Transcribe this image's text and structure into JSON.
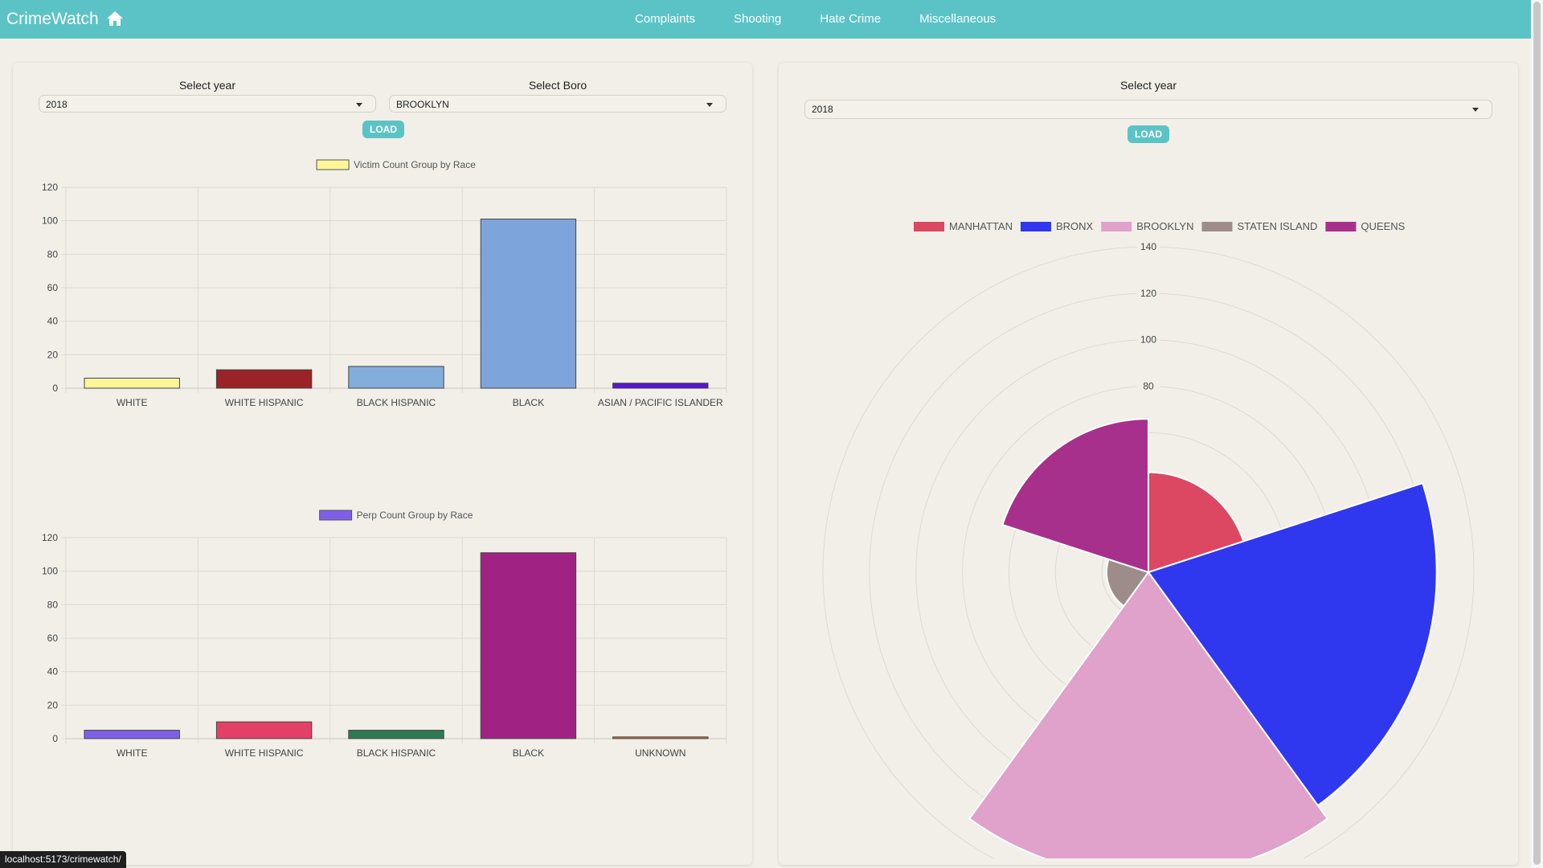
{
  "navbar": {
    "brand": "CrimeWatch",
    "links": [
      "Complaints",
      "Shooting",
      "Hate Crime",
      "Miscellaneous"
    ],
    "bg_color": "#5bc3c6"
  },
  "left_panel": {
    "year_label": "Select year",
    "year_value": "2018",
    "boro_label": "Select Boro",
    "boro_value": "BROOKLYN",
    "load_label": "LOAD"
  },
  "right_panel": {
    "year_label": "Select year",
    "year_value": "2018",
    "load_label": "LOAD"
  },
  "status_url": "localhost:5173/crimewatch/",
  "chart_data": [
    {
      "type": "bar",
      "legend": "Victim Count Group by Race",
      "legend_color": "#fdf59a",
      "categories": [
        "WHITE",
        "WHITE HISPANIC",
        "BLACK HISPANIC",
        "BLACK",
        "ASIAN / PACIFIC ISLANDER"
      ],
      "values": [
        6,
        11,
        13,
        101,
        3
      ],
      "colors": [
        "#fdf59a",
        "#9b2226",
        "#83aedc",
        "#7ea4dc",
        "#5a14d4"
      ],
      "yticks": [
        "0",
        "20",
        "40",
        "60",
        "80",
        "100",
        "120"
      ],
      "ylim": [
        0,
        120
      ]
    },
    {
      "type": "bar",
      "legend": "Perp Count Group by Race",
      "legend_color": "#7f5fe8",
      "categories": [
        "WHITE",
        "WHITE HISPANIC",
        "BLACK HISPANIC",
        "BLACK",
        "UNKNOWN"
      ],
      "values": [
        5,
        10,
        5,
        111,
        1
      ],
      "colors": [
        "#7f5fe8",
        "#e34067",
        "#2d7a55",
        "#a02384",
        "#d4703a"
      ],
      "yticks": [
        "0",
        "20",
        "40",
        "60",
        "80",
        "100",
        "120"
      ],
      "ylim": [
        0,
        120
      ]
    },
    {
      "type": "polar-area",
      "series": [
        {
          "name": "MANHATTAN",
          "value": 43,
          "color": "#dc4762"
        },
        {
          "name": "BRONX",
          "value": 124,
          "color": "#2f38ee"
        },
        {
          "name": "BROOKLYN",
          "value": 131,
          "color": "#e0a1cb"
        },
        {
          "name": "STATEN ISLAND",
          "value": 18,
          "color": "#9e8c8b"
        },
        {
          "name": "QUEENS",
          "value": 66,
          "color": "#a8308d"
        }
      ],
      "rticks": [
        "80",
        "100",
        "120",
        "140"
      ],
      "rlim": [
        0,
        140
      ]
    }
  ]
}
